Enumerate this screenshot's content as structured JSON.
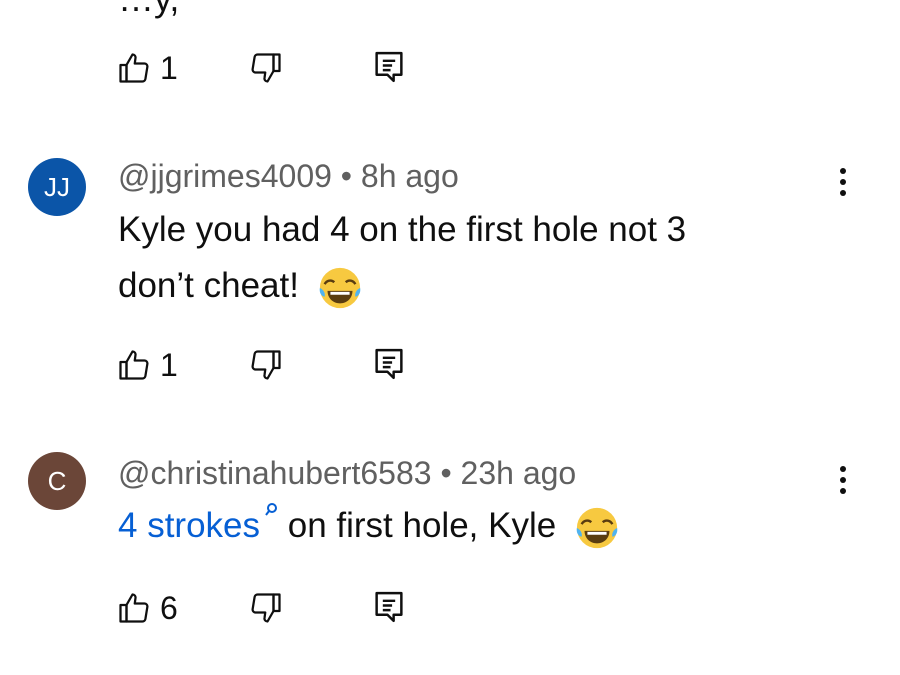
{
  "colors": {
    "link": "#065fd4",
    "avatar_jj": "#0b55a8",
    "avatar_c": "#6b4638",
    "meta": "#606060"
  },
  "icons": {
    "like": "thumbs-up-icon",
    "dislike": "thumbs-down-icon",
    "reply": "reply-comment-icon",
    "menu": "more-vert-icon",
    "laugh": "face-with-tears-of-joy-emoji"
  },
  "top_comment": {
    "partial_text": "…y,",
    "like_count": "1"
  },
  "comments": [
    {
      "avatar_initials": "JJ",
      "author": "@jjgrimes4009",
      "time": "8h ago",
      "text_line1": "Kyle you had 4 on the first hole not 3",
      "text_line2": "don’t cheat!",
      "like_count": "1"
    },
    {
      "avatar_initials": "C",
      "author": "@christinahubert6583",
      "time": "23h ago",
      "link_text": "4 strokes",
      "text_rest": "on first hole, Kyle",
      "like_count": "6"
    }
  ]
}
